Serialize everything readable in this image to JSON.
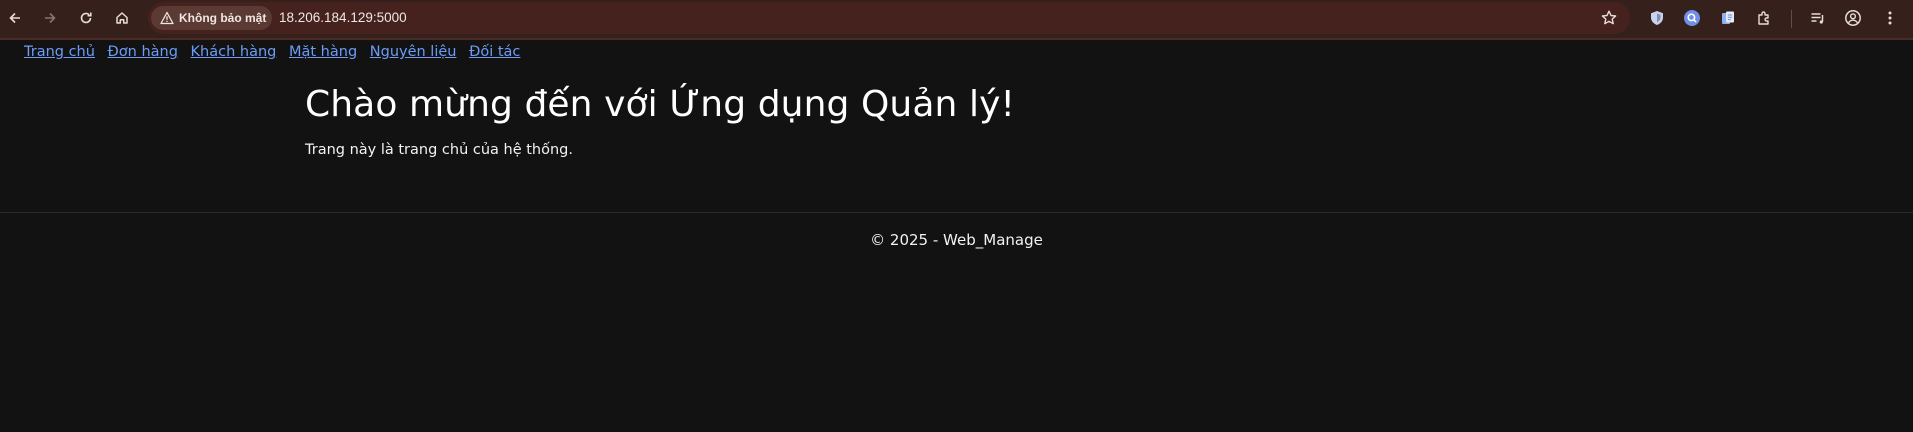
{
  "browser": {
    "security_chip": "Không bảo mật",
    "url": "18.206.184.129:5000",
    "icons": [
      "back-arrow-icon",
      "forward-arrow-icon",
      "reload-icon",
      "home-icon",
      "warning-icon",
      "star-icon",
      "shield-extension-icon",
      "search-extension-icon",
      "document-extension-icon",
      "puzzle-extensions-icon",
      "media-control-icon",
      "profile-icon",
      "more-vert-icon"
    ]
  },
  "nav": {
    "items": [
      "Trang chủ",
      "Đơn hàng",
      "Khách hàng",
      "Mặt hàng",
      "Nguyên liệu",
      "Đối tác"
    ]
  },
  "main": {
    "title": "Chào mừng đến với Ứng dụng Quản lý!",
    "subtitle": "Trang này là trang chủ của hệ thống."
  },
  "footer": {
    "text": "© 2025 - Web_Manage"
  },
  "colors": {
    "page_bg": "#121212",
    "toolbar_bg": "#35201c",
    "omnibox_bg": "#45221d",
    "link": "#6c9cf5"
  }
}
